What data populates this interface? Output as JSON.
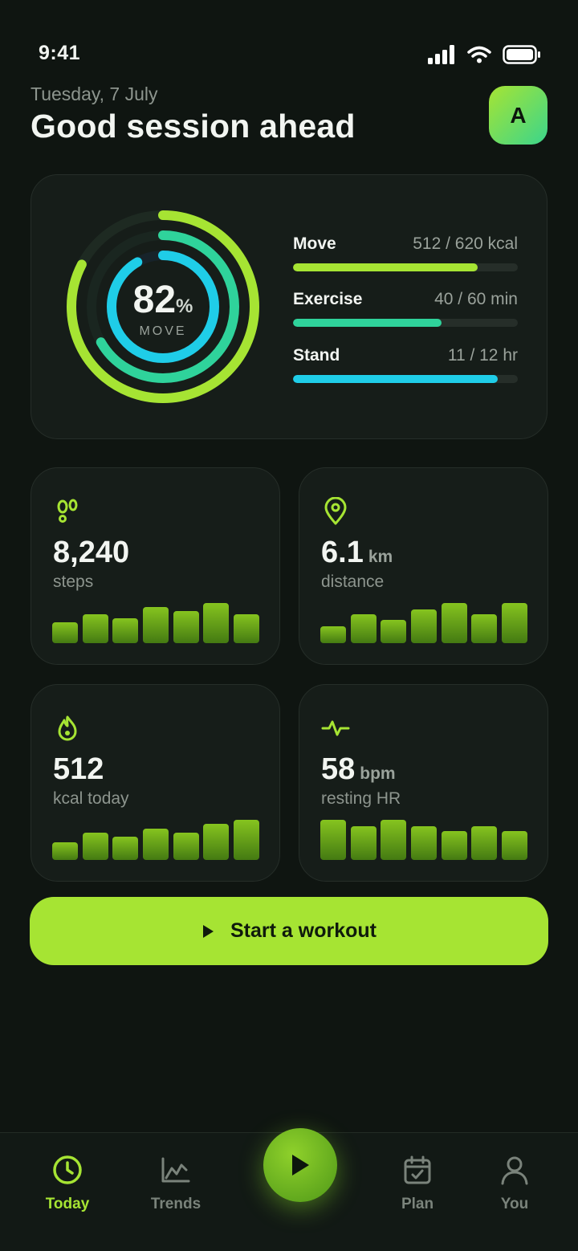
{
  "status_bar": {
    "time": "9:41"
  },
  "header": {
    "date": "Tuesday, 7 July",
    "greeting": "Good session ahead",
    "avatar_initial": "A"
  },
  "activity": {
    "percent": "82",
    "percent_sign": "%",
    "label": "MOVE",
    "rings": [
      {
        "name": "Move",
        "fraction": 0.826,
        "color": "#a6e433"
      },
      {
        "name": "Exercise",
        "fraction": 0.667,
        "color": "#2fd39b"
      },
      {
        "name": "Stand",
        "fraction": 0.917,
        "color": "#1fcde8"
      }
    ],
    "metrics": [
      {
        "name": "Move",
        "value": "512 / 620 kcal",
        "progress": 0.82,
        "color": "#a6e433"
      },
      {
        "name": "Exercise",
        "value": "40 / 60 min",
        "progress": 0.66,
        "color": "#2fd39b"
      },
      {
        "name": "Stand",
        "value": "11 / 12 hr",
        "progress": 0.91,
        "color": "#1fcde8"
      }
    ]
  },
  "stats": [
    {
      "icon": "footprints-icon",
      "value": "8,240",
      "unit": "",
      "label": "steps",
      "bars": [
        0.52,
        0.72,
        0.62,
        0.9,
        0.8,
        1.0,
        0.72
      ]
    },
    {
      "icon": "location-pin-icon",
      "value": "6.1",
      "unit": "km",
      "label": "distance",
      "bars": [
        0.42,
        0.72,
        0.58,
        0.85,
        1.0,
        0.72,
        1.0
      ]
    },
    {
      "icon": "flame-icon",
      "value": "512",
      "unit": "",
      "label": "kcal today",
      "bars": [
        0.45,
        0.68,
        0.58,
        0.78,
        0.68,
        0.9,
        1.0
      ]
    },
    {
      "icon": "heartbeat-icon",
      "value": "58",
      "unit": "bpm",
      "label": "resting HR",
      "bars": [
        1.0,
        0.85,
        1.0,
        0.85,
        0.72,
        0.85,
        0.72
      ]
    }
  ],
  "workout_button": {
    "label": "Start a workout"
  },
  "nav": {
    "items": [
      {
        "label": "Today",
        "icon": "clock-icon",
        "active": true
      },
      {
        "label": "Trends",
        "icon": "trend-chart-icon",
        "active": false
      },
      {
        "label": "Plan",
        "icon": "calendar-check-icon",
        "active": false
      },
      {
        "label": "You",
        "icon": "user-icon",
        "active": false
      }
    ],
    "fab_icon": "play-icon"
  },
  "colors": {
    "accent": "#a6e433",
    "background": "#0f1511",
    "card": "#161d19"
  }
}
